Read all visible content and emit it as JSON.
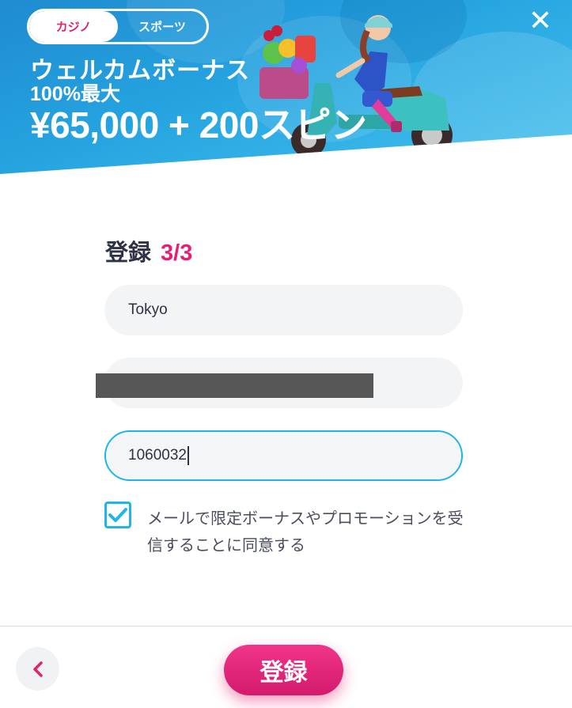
{
  "header": {
    "tabs": [
      {
        "label": "カジノ",
        "active": true
      },
      {
        "label": "スポーツ",
        "active": false
      }
    ],
    "close_icon": "close-icon",
    "promo": {
      "line1": "ウェルカムボーナス",
      "line2": "100%最大",
      "line3": "¥65,000 + 200スピン"
    }
  },
  "form": {
    "title": "登録",
    "step": "3/3",
    "fields": [
      {
        "name": "city",
        "value": "Tokyo"
      },
      {
        "name": "address",
        "value": ""
      },
      {
        "name": "postal-code",
        "value": "1060032",
        "focused": true
      }
    ],
    "consent": {
      "checked": true,
      "text": "メールで限定ボーナスやプロモーションを受信することに同意する"
    }
  },
  "footer": {
    "back_icon": "chevron-left-icon",
    "submit_label": "登録"
  },
  "colors": {
    "accent_pink": "#e81e76",
    "focus_blue": "#1fb5e9",
    "banner_blue": "#25a4e0"
  }
}
